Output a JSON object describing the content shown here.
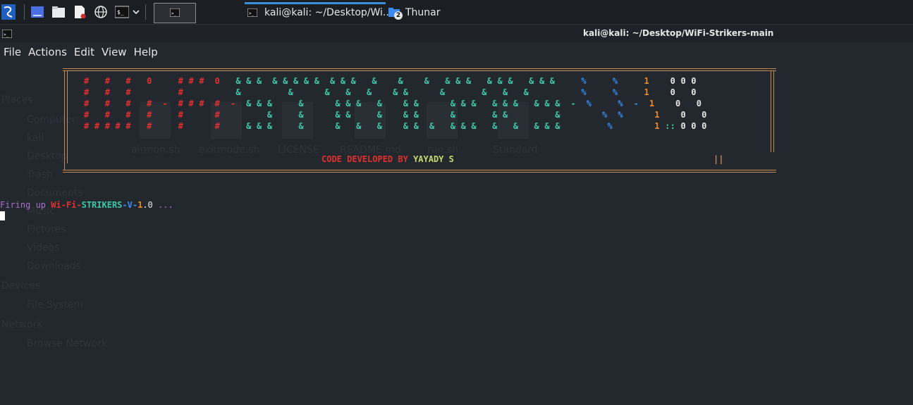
{
  "taskbar": {
    "task1_title": "kali@kali: ~/Desktop/Wi...",
    "task2_title": "Thunar",
    "task2_badge": "2"
  },
  "window": {
    "title": "kali@kali: ~/Desktop/WiFi-Strikers-main"
  },
  "menu": [
    "File",
    "Actions",
    "Edit",
    "View",
    "Help"
  ],
  "background_thunar": {
    "places_heading": "Places",
    "places": [
      "Computer",
      "kali",
      "Desktop",
      "Trash",
      "Documents",
      "Music",
      "Pictures",
      "Videos",
      "Downloads"
    ],
    "devices_heading": "Devices",
    "devices": [
      "File System"
    ],
    "network_heading": "Network",
    "network": [
      "Browse Network"
    ],
    "files": [
      "airmon.sh",
      "exitmode.sh",
      "LICENSE",
      "README.md",
      "run.sh",
      "Standard"
    ]
  },
  "banner": {
    "art_lines": [
      [
        [
          "r",
          "#   #   #   0     # # #  0   "
        ],
        [
          "g",
          "& & &  & & & & &  & & &   &    &    &   & & &   & & &   & & &     "
        ],
        [
          "b",
          "%     %     "
        ],
        [
          "o",
          "1    "
        ],
        [
          "w",
          "0 0 0"
        ]
      ],
      [
        [
          "r",
          "#   #   #         #          "
        ],
        [
          "g",
          "&         &      &   &   &    & &      &       &   &   &          "
        ],
        [
          "b",
          "%     %     "
        ],
        [
          "o",
          "1    "
        ],
        [
          "w",
          "0   0"
        ]
      ],
      [
        [
          "r",
          "#   #   #   #  -  # # #  #  -  "
        ],
        [
          "g",
          "& & &     &      & & &   &    & &      & & &   & & &   & & &  -  "
        ],
        [
          "b",
          "%     %  -  "
        ],
        [
          "o",
          "1    "
        ],
        [
          "w",
          "0   0"
        ]
      ],
      [
        [
          "r",
          "#   #   #   #     #      #     "
        ],
        [
          "g",
          "    &     &      & &     &    & &      &       & &         &      "
        ],
        [
          "b",
          "  %  %      "
        ],
        [
          "o",
          "1    "
        ],
        [
          "w",
          "0   0"
        ]
      ],
      [
        [
          "r",
          "# # # # #   #     #      #     "
        ],
        [
          "g",
          "& & &     &      &   &   &    & &  &   & & &   &   &   & & &      "
        ],
        [
          "b",
          "   %        "
        ],
        [
          "o",
          "1 "
        ],
        [
          "g",
          ":: "
        ],
        [
          "w",
          "0 0 0"
        ]
      ]
    ],
    "credit_label": "CODE DEVELOPED BY",
    "credit_author": "YAYADY S",
    "credit_bar": "||"
  },
  "terminal": {
    "firing_prefix": "Firing up ",
    "name_wifi": "Wi-Fi-",
    "name_strikers": "STRIKERS",
    "name_sep": "-V-",
    "version_major": "1",
    "version_rest": ".0",
    "ellipsis": " ..."
  },
  "colors": {
    "background": "#23272e",
    "accent": "#3b8fd9",
    "banner_border": "#c98b4d"
  }
}
